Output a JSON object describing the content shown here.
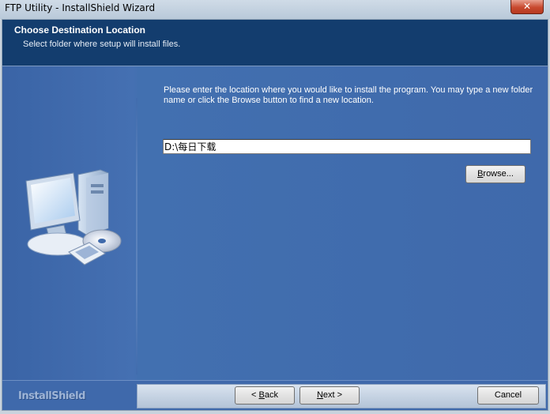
{
  "window": {
    "title": "FTP Utility - InstallShield Wizard",
    "close_glyph": "✕"
  },
  "header": {
    "title": "Choose Destination Location",
    "subtitle": "Select folder where setup will install files."
  },
  "body": {
    "instructions": "Please enter the location where you would like to install the program.  You may type a new folder name or click the Browse button to find a new location.",
    "path_value": "D:\\每日下载"
  },
  "buttons": {
    "browse": {
      "pre": "",
      "key": "B",
      "post": "rowse..."
    },
    "back": {
      "pre": "< ",
      "key": "B",
      "post": "ack"
    },
    "next": {
      "pre": "",
      "key": "N",
      "post": "ext >"
    },
    "cancel": {
      "label": "Cancel"
    }
  },
  "footer": {
    "brand": "InstallShield"
  },
  "colors": {
    "header": "#133d6e",
    "panel": "#3f69ab",
    "footer_bar": "#c5d2e3"
  }
}
